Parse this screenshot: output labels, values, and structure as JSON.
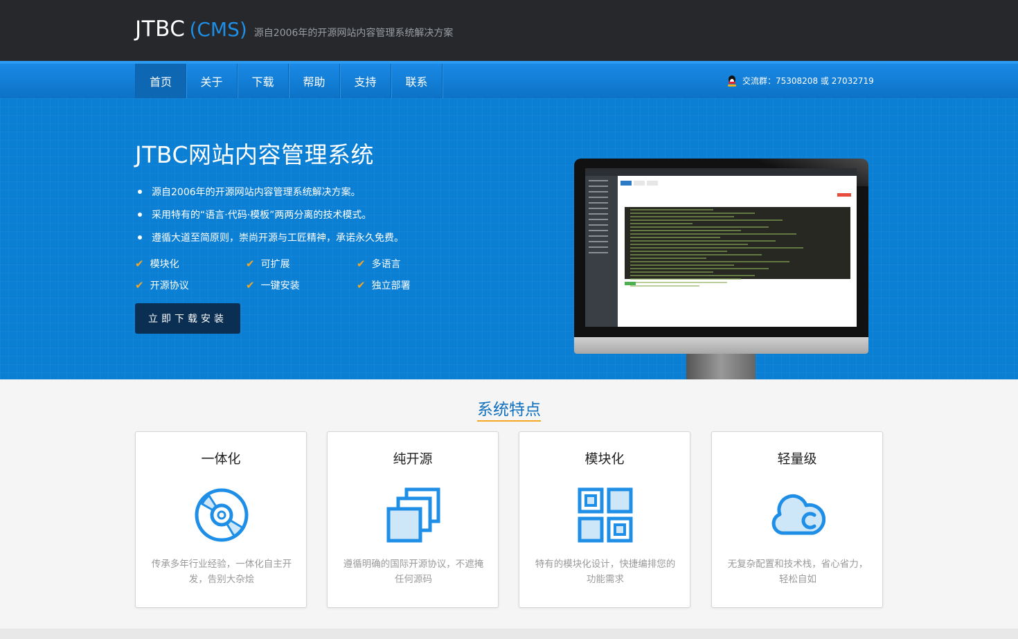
{
  "header": {
    "brand": "JTBC",
    "brand_suffix": "(CMS)",
    "slogan": "源自2006年的开源网站内容管理系统解决方案"
  },
  "nav": {
    "items": [
      "首页",
      "关于",
      "下载",
      "帮助",
      "支持",
      "联系"
    ],
    "active": "首页",
    "qq_group": "交流群：75308208 或 27032719"
  },
  "hero": {
    "title": "JTBC网站内容管理系统",
    "points": [
      "源自2006年的开源网站内容管理系统解决方案。",
      "采用特有的“语言·代码·模板”两两分离的技术模式。",
      "遵循大道至简原则，崇尚开源与工匠精神，承诺永久免费。"
    ],
    "features": [
      "模块化",
      "可扩展",
      "多语言",
      "开源协议",
      "一键安装",
      "独立部署"
    ],
    "download_button": "立即下载安装"
  },
  "section": {
    "title": "系统特点",
    "cards": [
      {
        "title": "一体化",
        "desc": "传承多年行业经验，一体化自主开发，告别大杂烩",
        "icon": "disc-icon"
      },
      {
        "title": "纯开源",
        "desc": "遵循明确的国际开源协议，不遮掩任何源码",
        "icon": "stacked-windows-icon"
      },
      {
        "title": "模块化",
        "desc": "特有的模块化设计，快捷编排您的功能需求",
        "icon": "module-grid-icon"
      },
      {
        "title": "轻量级",
        "desc": "无复杂配置和技术栈，省心省力，轻松自如",
        "icon": "cloud-icon"
      }
    ]
  },
  "colors": {
    "accent": "#0b7fd4",
    "header_bg": "#26282b",
    "check": "#f5a623",
    "icon_blue": "#1e8ee6"
  }
}
